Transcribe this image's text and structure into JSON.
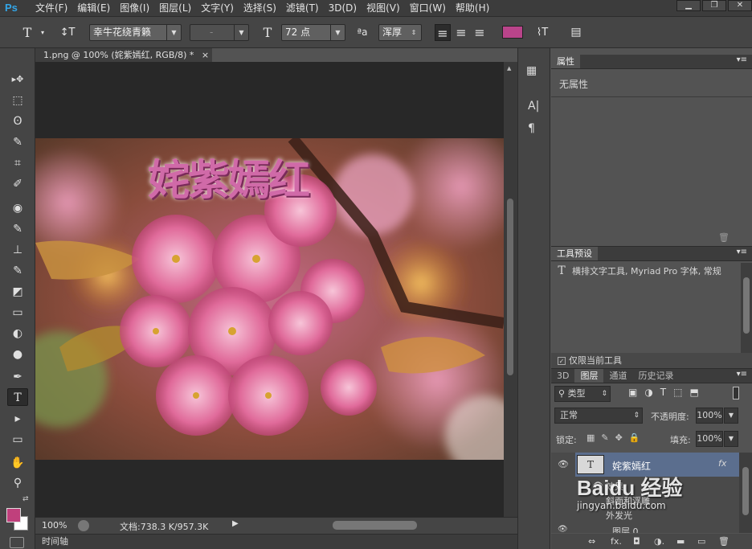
{
  "app": {
    "logo": "Ps"
  },
  "menubar": {
    "items": [
      "文件(F)",
      "编辑(E)",
      "图像(I)",
      "图层(L)",
      "文字(Y)",
      "选择(S)",
      "滤镜(T)",
      "3D(D)",
      "视图(V)",
      "窗口(W)",
      "帮助(H)"
    ]
  },
  "window_controls": {
    "minimize": "▁",
    "restore": "❐",
    "close": "✕"
  },
  "options": {
    "tool_icon": "T",
    "orient_icon": "↕T",
    "font_family": "幸牛花绕青籁",
    "font_style": "-",
    "size_icon": "T",
    "font_size": "72 点",
    "aa_icon": "ªa",
    "antialias": "浑厚",
    "align": [
      "≡",
      "≡",
      "≡"
    ],
    "color": "#b9448a",
    "warp_icon": "⌇T",
    "panels_icon": "▤"
  },
  "document": {
    "tab_title": "1.png @ 100% (姹紫嫣红, RGB/8) *",
    "close": "×",
    "canvas_text": "姹紫嫣红",
    "zoom": "100%",
    "doc_info": "文档:738.3 K/957.3K",
    "timeline": "时间轴"
  },
  "tools": [
    "▸✥",
    "⬚",
    "ʘ",
    "✎",
    "⌗",
    "✐",
    "◉",
    "✎",
    "⊥",
    "✎",
    "◩",
    "▭",
    "◐",
    "●",
    "✒",
    "T",
    "▸",
    "▭",
    "✋",
    "⚲"
  ],
  "colors": {
    "foreground": "#c0407c",
    "background": "#ffffff"
  },
  "properties": {
    "tab": "属性",
    "content": "无属性"
  },
  "tool_presets": {
    "tab": "工具预设",
    "icon": "T",
    "item": "横排文字工具, Myriad Pro 字体, 常规",
    "checkbox_label": "仅限当前工具",
    "checked": true
  },
  "layers": {
    "tabs": [
      "3D",
      "图层",
      "通道",
      "历史记录"
    ],
    "active_tab": "图层",
    "filter_kind": "类型",
    "blend_mode": "正常",
    "opacity_label": "不透明度:",
    "opacity": "100%",
    "lock_label": "锁定:",
    "fill_label": "填充:",
    "fill": "100%",
    "items": [
      {
        "name": "姹紫嫣红",
        "thumb": "T",
        "fx": "fx"
      },
      {
        "name": "效果"
      },
      {
        "name": "斜面和浮雕"
      },
      {
        "name": "外发光"
      },
      {
        "name": "图层 0"
      }
    ],
    "footer_icons": [
      "⇔",
      "fx.",
      "◘",
      "◑.",
      "▬",
      "▭",
      "🗑"
    ]
  },
  "watermark": {
    "brand": "Baidu 经验",
    "url": "jingyan.baidu.com"
  }
}
